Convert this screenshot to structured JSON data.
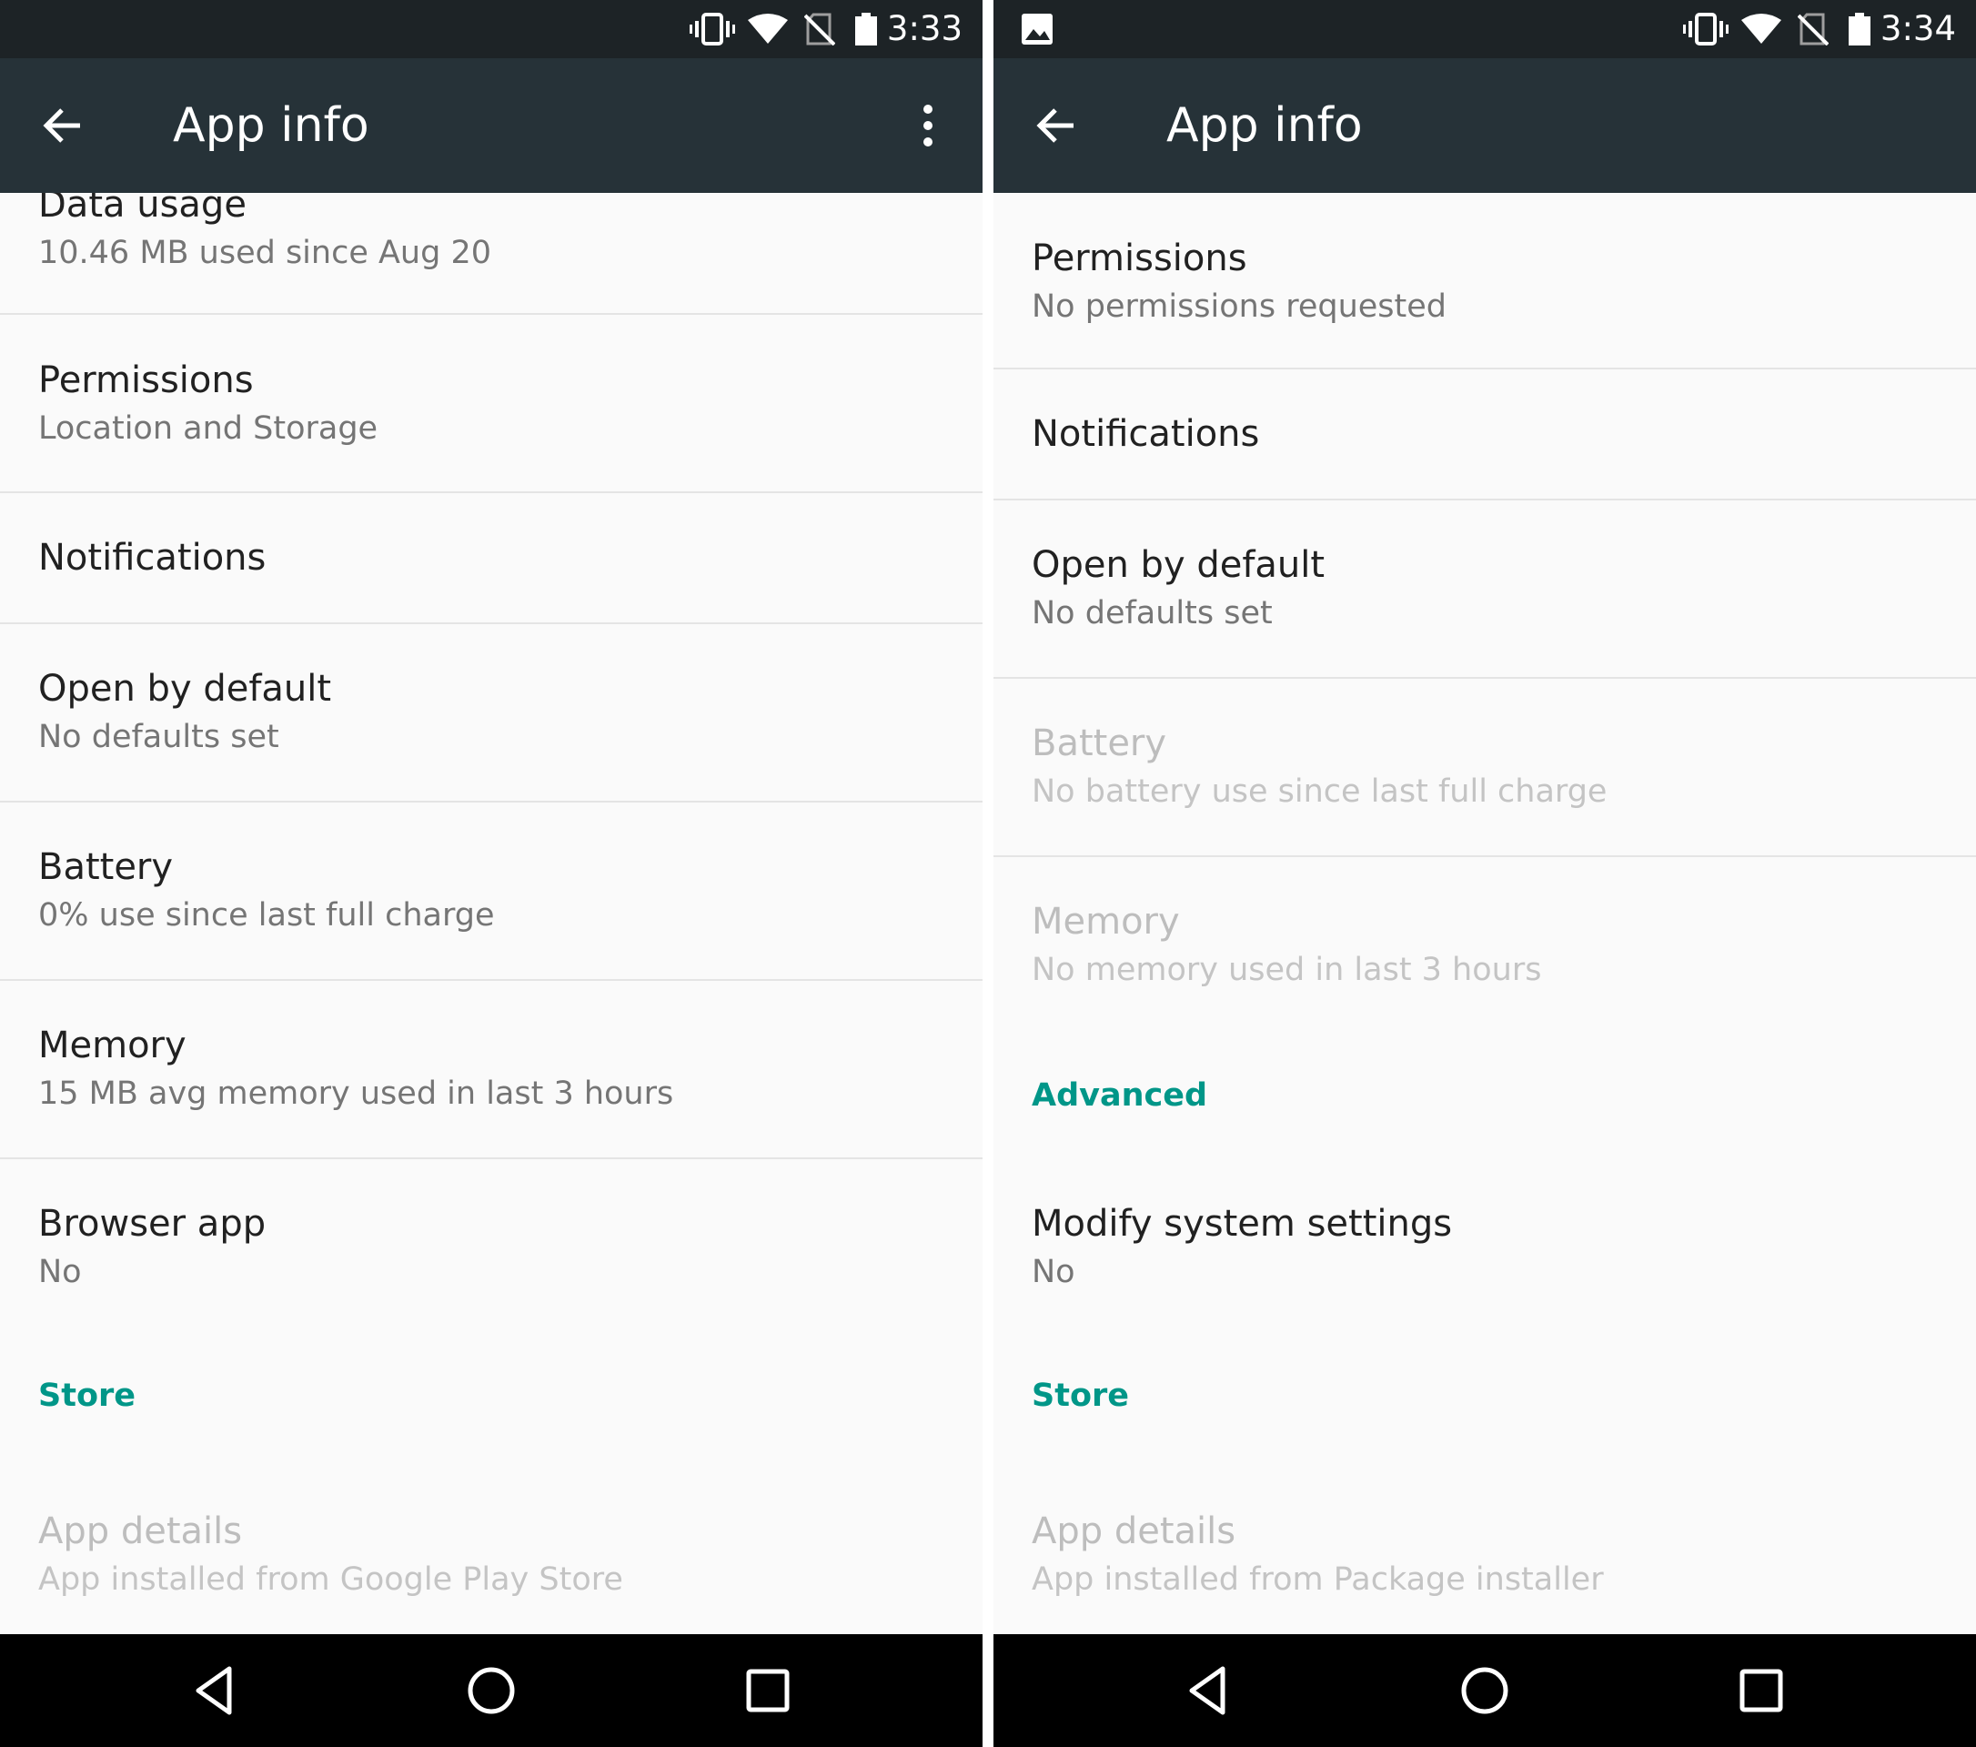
{
  "left": {
    "status_time": "3:33",
    "toolbar_title": "App info",
    "rows": [
      {
        "title": "Data usage",
        "summary": "10.46 MB used since Aug 20"
      },
      {
        "title": "Permissions",
        "summary": "Location and Storage"
      },
      {
        "title": "Notifications"
      },
      {
        "title": "Open by default",
        "summary": "No defaults set"
      },
      {
        "title": "Battery",
        "summary": "0% use since last full charge"
      },
      {
        "title": "Memory",
        "summary": "15 MB avg memory used in last 3 hours"
      },
      {
        "title": "Browser app",
        "summary": "No"
      }
    ],
    "store_header": "Store",
    "app_details": {
      "title": "App details",
      "summary": "App installed from Google Play Store"
    }
  },
  "right": {
    "status_time": "3:34",
    "toolbar_title": "App info",
    "rows": [
      {
        "title": "Permissions",
        "summary": "No permissions requested"
      },
      {
        "title": "Notifications"
      },
      {
        "title": "Open by default",
        "summary": "No defaults set"
      },
      {
        "title": "Battery",
        "summary": "No battery use since last full charge"
      },
      {
        "title": "Memory",
        "summary": "No memory used in last 3 hours"
      }
    ],
    "advanced_header": "Advanced",
    "modify_system": {
      "title": "Modify system settings",
      "summary": "No"
    },
    "store_header": "Store",
    "app_details": {
      "title": "App details",
      "summary": "App installed from Package installer"
    }
  },
  "colors": {
    "toolbar": "#263238",
    "statusbar": "#1d2326",
    "accent": "#009688",
    "background": "#fafafa"
  },
  "icons": [
    "vibrate-icon",
    "wifi-icon",
    "no-sim-icon",
    "battery-icon",
    "image-notification-icon",
    "back-arrow-icon",
    "overflow-menu-icon",
    "nav-back-icon",
    "nav-home-icon",
    "nav-recents-icon"
  ]
}
